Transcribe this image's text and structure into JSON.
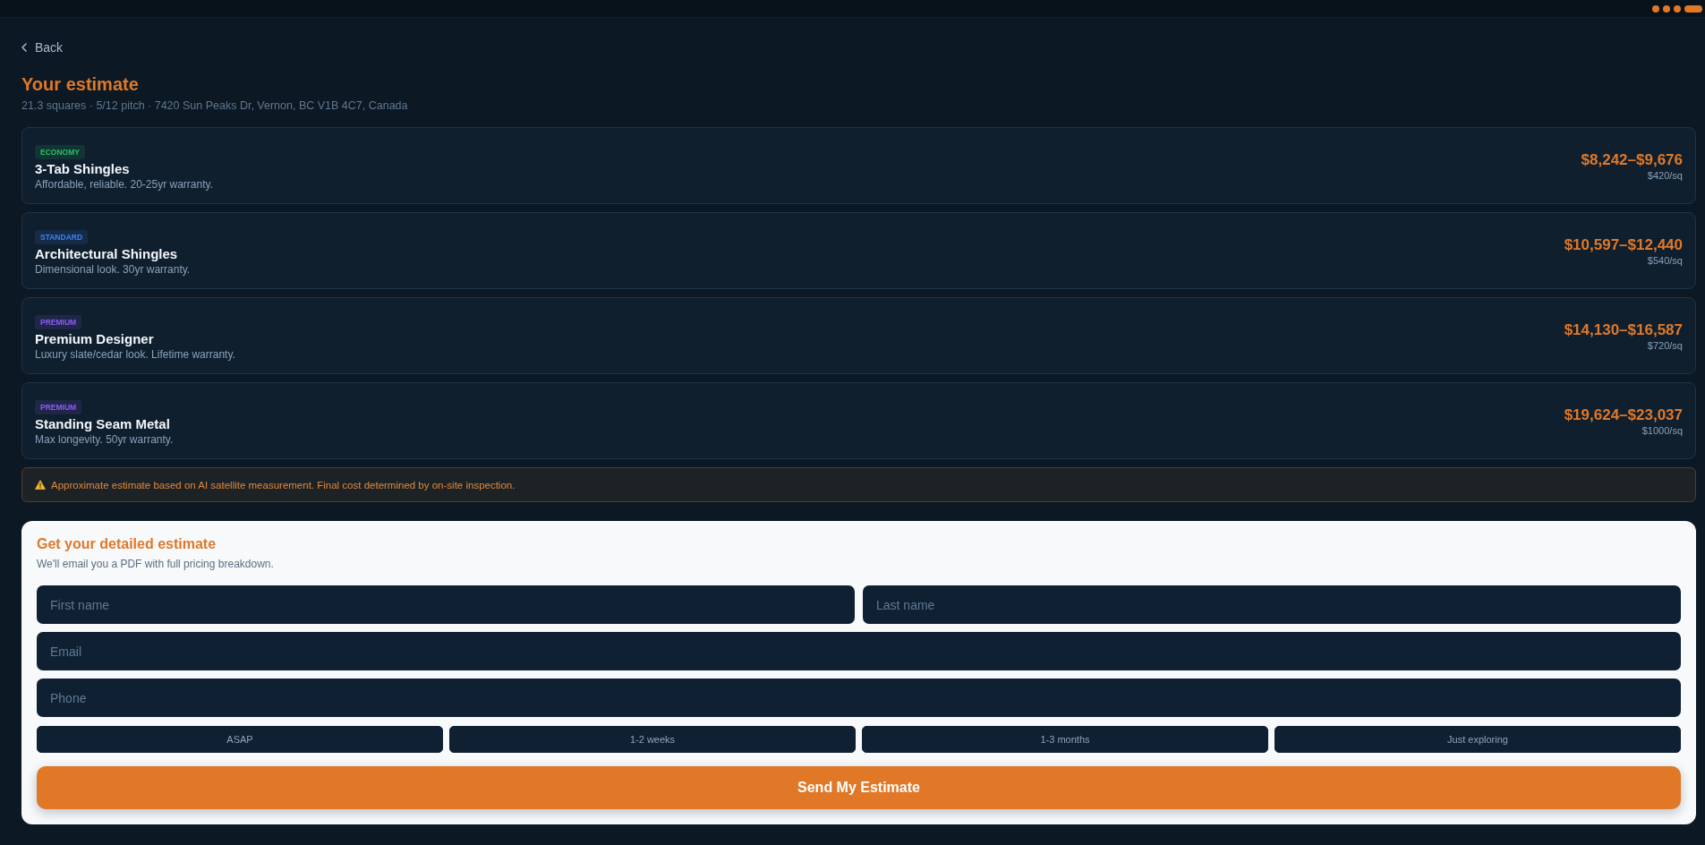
{
  "back_link": {
    "label": "Back"
  },
  "header": {
    "title": "Your estimate",
    "subtitle": "21.3 squares · 5/12 pitch · 7420 Sun Peaks Dr, Vernon, BC V1B 4C7, Canada"
  },
  "options": [
    {
      "badge": {
        "label": "ECONOMY",
        "color": "#22c55e"
      },
      "name": "3-Tab Shingles",
      "description": "Affordable, reliable. 20-25yr warranty.",
      "price_range": "$8,242–$9,676",
      "unit_price": "$420/sq"
    },
    {
      "badge": {
        "label": "STANDARD",
        "color": "#3b82f6"
      },
      "name": "Architectural Shingles",
      "description": "Dimensional look. 30yr warranty.",
      "price_range": "$10,597–$12,440",
      "unit_price": "$540/sq"
    },
    {
      "badge": {
        "label": "PREMIUM",
        "color": "#8b5cf6"
      },
      "name": "Premium Designer",
      "description": "Luxury slate/cedar look. Lifetime warranty.",
      "price_range": "$14,130–$16,587",
      "unit_price": "$720/sq"
    },
    {
      "badge": {
        "label": "PREMIUM",
        "color": "#8b5cf6"
      },
      "name": "Standing Seam Metal",
      "description": "Max longevity. 50yr warranty.",
      "price_range": "$19,624–$23,037",
      "unit_price": "$1000/sq"
    }
  ],
  "notice": {
    "text": "Approximate estimate based on AI satellite measurement. Final cost determined by on-site inspection."
  },
  "lead_form": {
    "title": "Get your detailed estimate",
    "subtitle": "We'll email you a PDF with full pricing breakdown.",
    "first_name": {
      "placeholder": "First name"
    },
    "last_name": {
      "placeholder": "Last name"
    },
    "email": {
      "placeholder": "Email"
    },
    "phone": {
      "placeholder": "Phone"
    },
    "timeline_options": [
      {
        "label": "ASAP",
        "selected": false
      },
      {
        "label": "1-2 weeks",
        "selected": false
      },
      {
        "label": "1-3 months",
        "selected": false
      },
      {
        "label": "Just exploring",
        "selected": false
      }
    ],
    "submit_button": {
      "label": "Send My Estimate"
    }
  }
}
